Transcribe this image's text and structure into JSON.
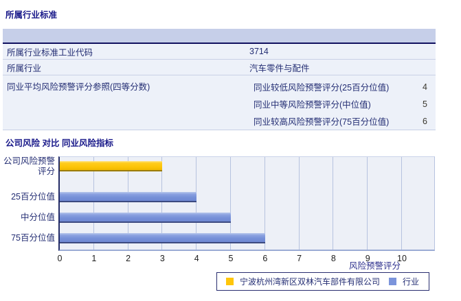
{
  "section1": {
    "title": "所属行业标准",
    "table": {
      "rows": [
        {
          "label": "所属行业标准工业代码",
          "value": "3714"
        },
        {
          "label": "所属行业",
          "value": "汽车零件与配件"
        }
      ],
      "group_row": {
        "label": "同业平均风险预警评分参照(四等分数)",
        "items": [
          {
            "label": "同业较低风险预警评分(25百分位值)",
            "value": "4"
          },
          {
            "label": "同业中等风险预警评分(中位值)",
            "value": "5"
          },
          {
            "label": "同业较高风险预警评分(75百分位值)",
            "value": "6"
          }
        ]
      }
    }
  },
  "section2": {
    "title": "公司风险 对比 同业风险指标"
  },
  "chart_data": {
    "type": "bar",
    "orientation": "horizontal",
    "title": "公司风险 对比 同业风险指标",
    "categories": [
      "公司风险预警评分",
      "25百分位值",
      "中分位值",
      "75百分位值"
    ],
    "categories_display": [
      "公司风险预警\n评分",
      "25百分位值",
      "中分位值",
      "75百分位值"
    ],
    "values": [
      3,
      4,
      5,
      6
    ],
    "bar_series": [
      "company",
      "industry",
      "industry",
      "industry"
    ],
    "xlabel": "风险预警评分",
    "xticks": [
      0,
      1,
      2,
      3,
      4,
      5,
      6,
      7,
      8,
      9,
      10
    ],
    "xlim": [
      0,
      11
    ],
    "grid": "vertical",
    "legend_position": "bottom",
    "colors": {
      "company": "#FFC60A",
      "industry": "#7B94DB",
      "plot_background": "#EDF0F7",
      "gridline": "#B6C2DF",
      "axis": "#232B66"
    },
    "legend": [
      {
        "series": "company",
        "label": "宁波杭州湾新区双林汽车部件有限公司",
        "color": "#FFC60A"
      },
      {
        "series": "industry",
        "label": "行业",
        "color": "#7B94DB"
      }
    ]
  }
}
